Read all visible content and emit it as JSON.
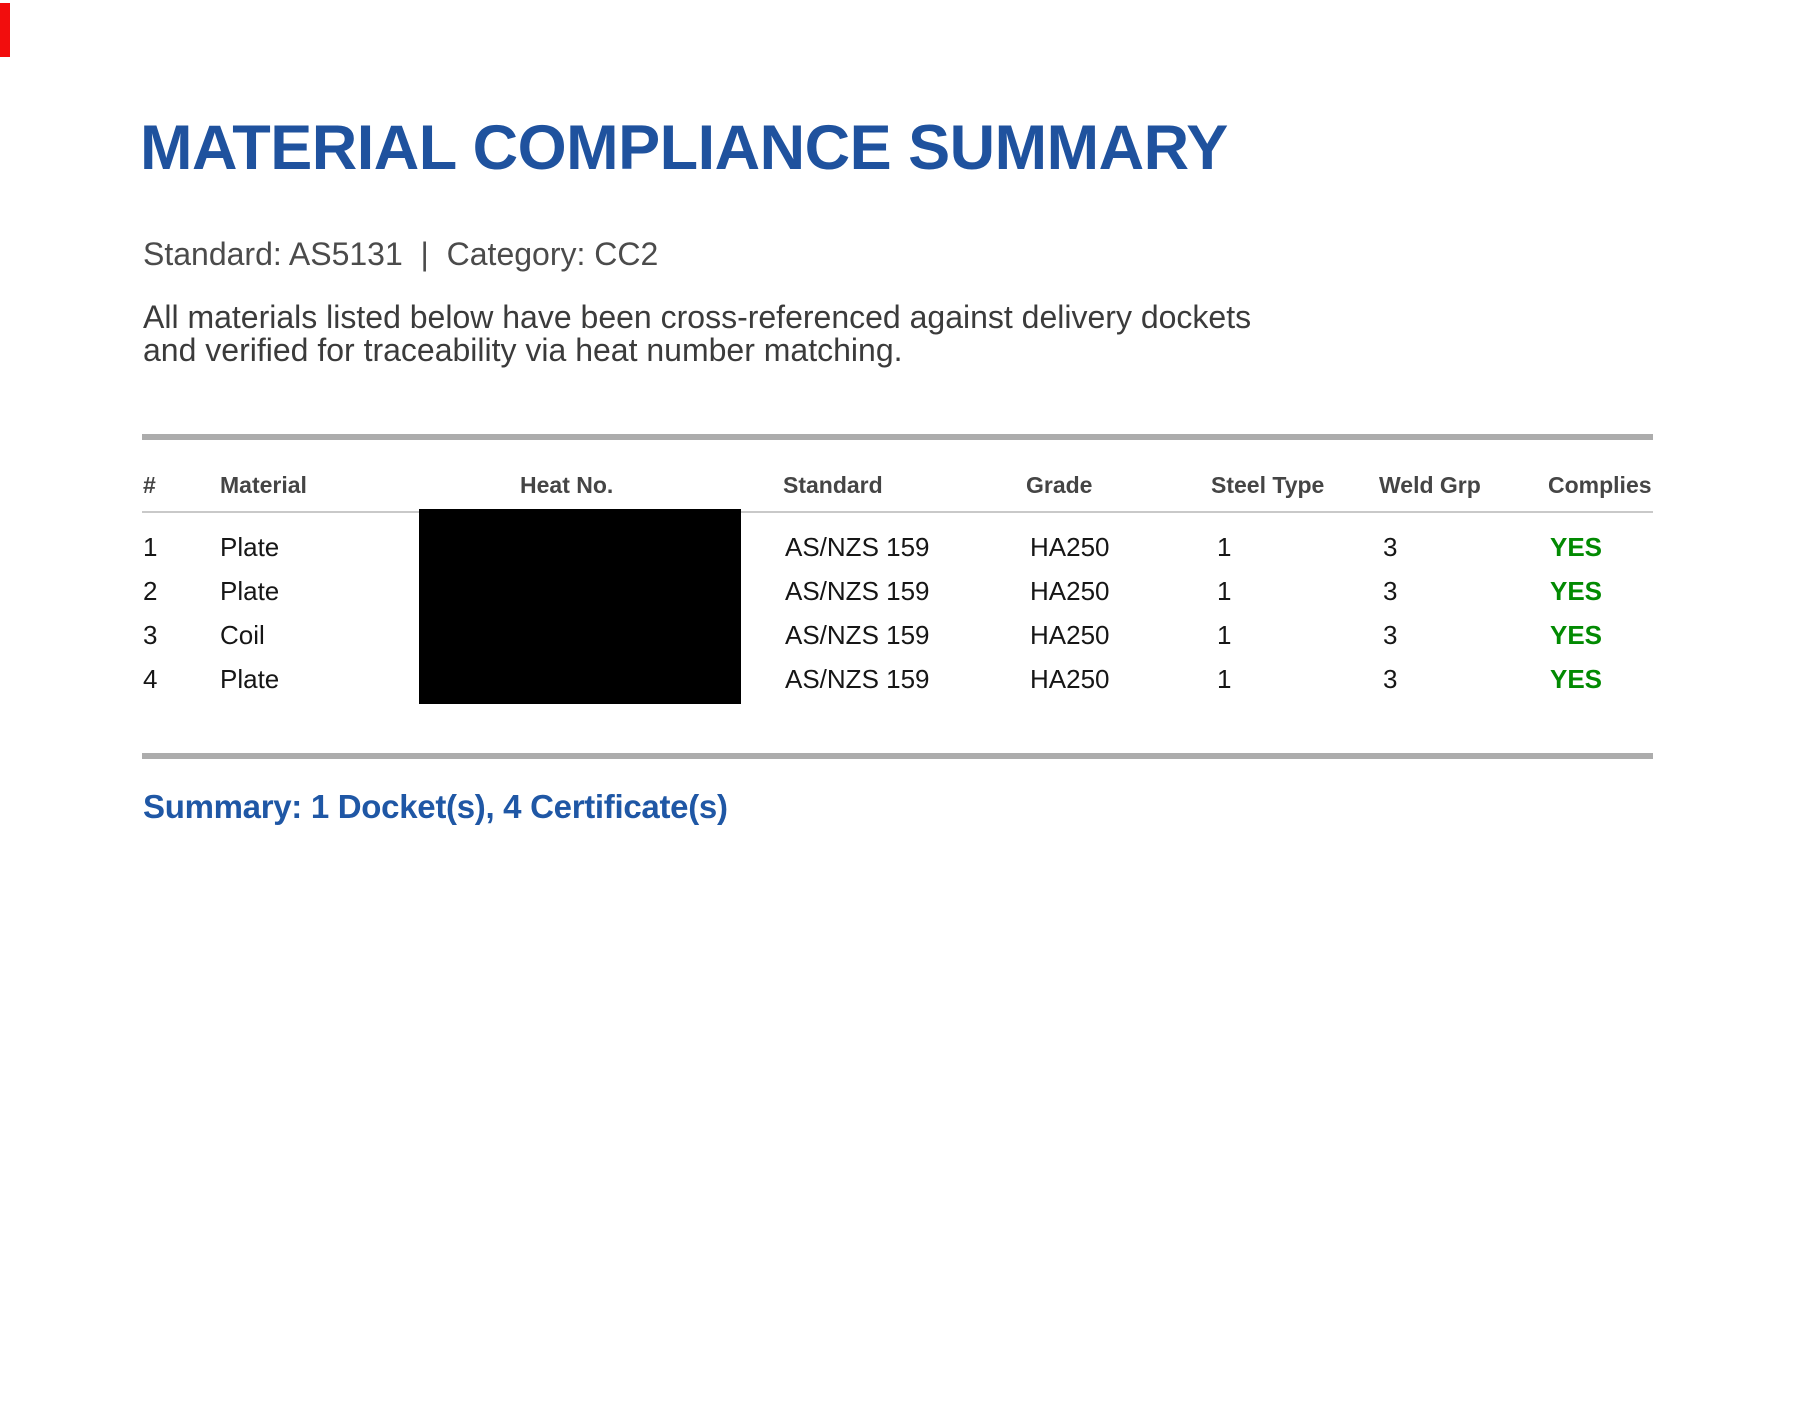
{
  "title": "MATERIAL COMPLIANCE SUMMARY",
  "subtitle": "Standard: AS5131  |  Category: CC2",
  "description": "All materials listed below have been cross-referenced against delivery dockets\nand verified for traceability via heat number matching.",
  "table": {
    "headers": [
      "#",
      "Material",
      "Heat No.",
      "Standard",
      "Grade",
      "Steel Type",
      "Weld Grp",
      "Complies"
    ],
    "heat_no_redacted": true,
    "rows": [
      {
        "num": "1",
        "material": "Plate",
        "heat_no": "",
        "standard": "AS/NZS 159",
        "grade": "HA250",
        "steel_type": "1",
        "weld_grp": "3",
        "complies": "YES"
      },
      {
        "num": "2",
        "material": "Plate",
        "heat_no": "",
        "standard": "AS/NZS 159",
        "grade": "HA250",
        "steel_type": "1",
        "weld_grp": "3",
        "complies": "YES"
      },
      {
        "num": "3",
        "material": "Coil",
        "heat_no": "",
        "standard": "AS/NZS 159",
        "grade": "HA250",
        "steel_type": "1",
        "weld_grp": "3",
        "complies": "YES"
      },
      {
        "num": "4",
        "material": "Plate",
        "heat_no": "",
        "standard": "AS/NZS 159",
        "grade": "HA250",
        "steel_type": "1",
        "weld_grp": "3",
        "complies": "YES"
      }
    ]
  },
  "summary": "Summary: 1 Docket(s), 4 Certificate(s)",
  "colors": {
    "title_blue": "#1f529e",
    "summary_blue": "#1f57a5",
    "complies_green": "#028a02",
    "rule_gray": "#acacac",
    "redaction_black": "#000000",
    "corner_marker_red": "#f20d0d"
  }
}
